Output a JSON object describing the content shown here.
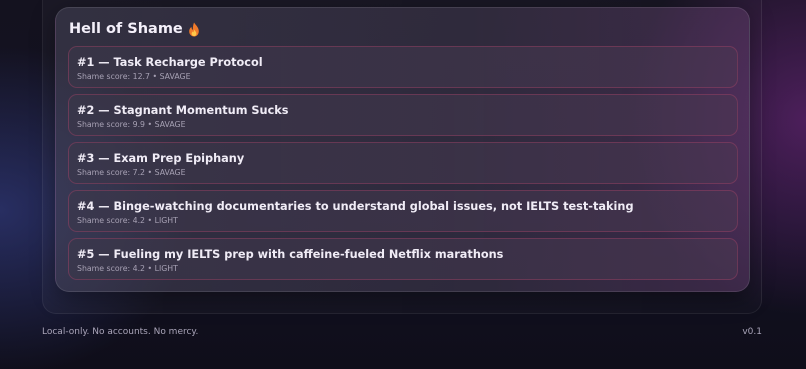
{
  "hall": {
    "title": "Hell of Shame",
    "icon": "fire-icon",
    "items": [
      {
        "rank": "#1",
        "title": "Task Recharge Protocol",
        "score": "12.7",
        "level": "SAVAGE"
      },
      {
        "rank": "#2",
        "title": "Stagnant Momentum Sucks",
        "score": "9.9",
        "level": "SAVAGE"
      },
      {
        "rank": "#3",
        "title": "Exam Prep Epiphany",
        "score": "7.2",
        "level": "SAVAGE"
      },
      {
        "rank": "#4",
        "title": "Binge-watching documentaries to understand global issues, not IELTS test-taking",
        "score": "4.2",
        "level": "LIGHT"
      },
      {
        "rank": "#5",
        "title": "Fueling my IELTS prep with caffeine-fueled Netflix marathons",
        "score": "4.2",
        "level": "LIGHT"
      }
    ],
    "score_label": "Shame score:",
    "separator": "•",
    "dash": "—"
  },
  "footer": {
    "tagline": "Local-only. No accounts. No mercy.",
    "version": "v0.1"
  },
  "colors": {
    "item_border": "#be466e",
    "fire": "#f07a2a"
  }
}
